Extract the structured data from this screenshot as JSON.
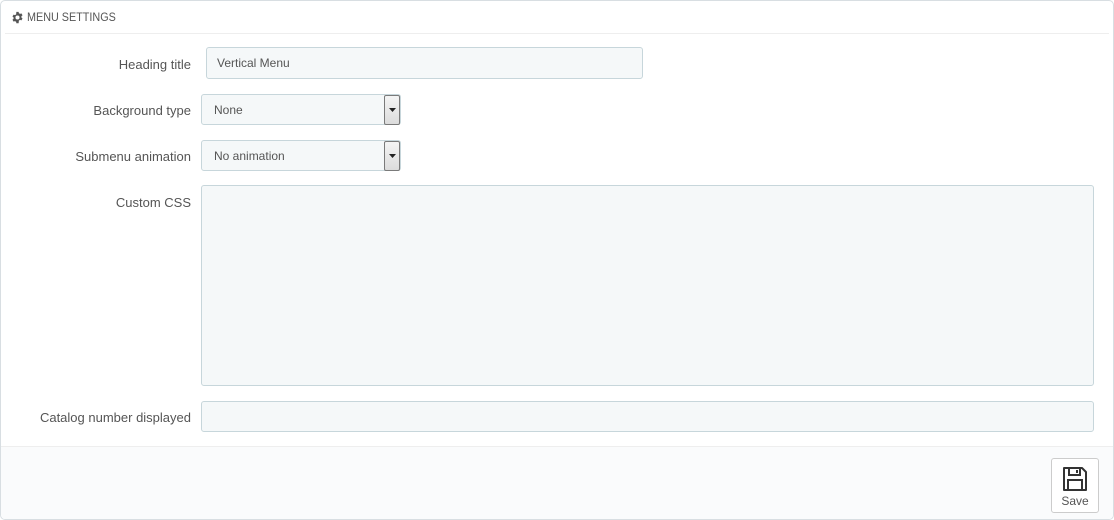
{
  "panel": {
    "title": "MENU SETTINGS",
    "icon": "gear-icon"
  },
  "form": {
    "heading_title": {
      "label": "Heading title",
      "value": "Vertical Menu"
    },
    "background_type": {
      "label": "Background type",
      "selected": "None"
    },
    "submenu_animation": {
      "label": "Submenu animation",
      "selected": "No animation"
    },
    "custom_css": {
      "label": "Custom CSS",
      "value": ""
    },
    "catalog_number": {
      "label": "Catalog number displayed",
      "value": ""
    }
  },
  "footer": {
    "save_label": "Save",
    "save_icon": "floppy-disk-icon"
  },
  "colors": {
    "input_bg": "#f5f8f9",
    "input_border": "#c7d6db",
    "text": "#555555"
  }
}
